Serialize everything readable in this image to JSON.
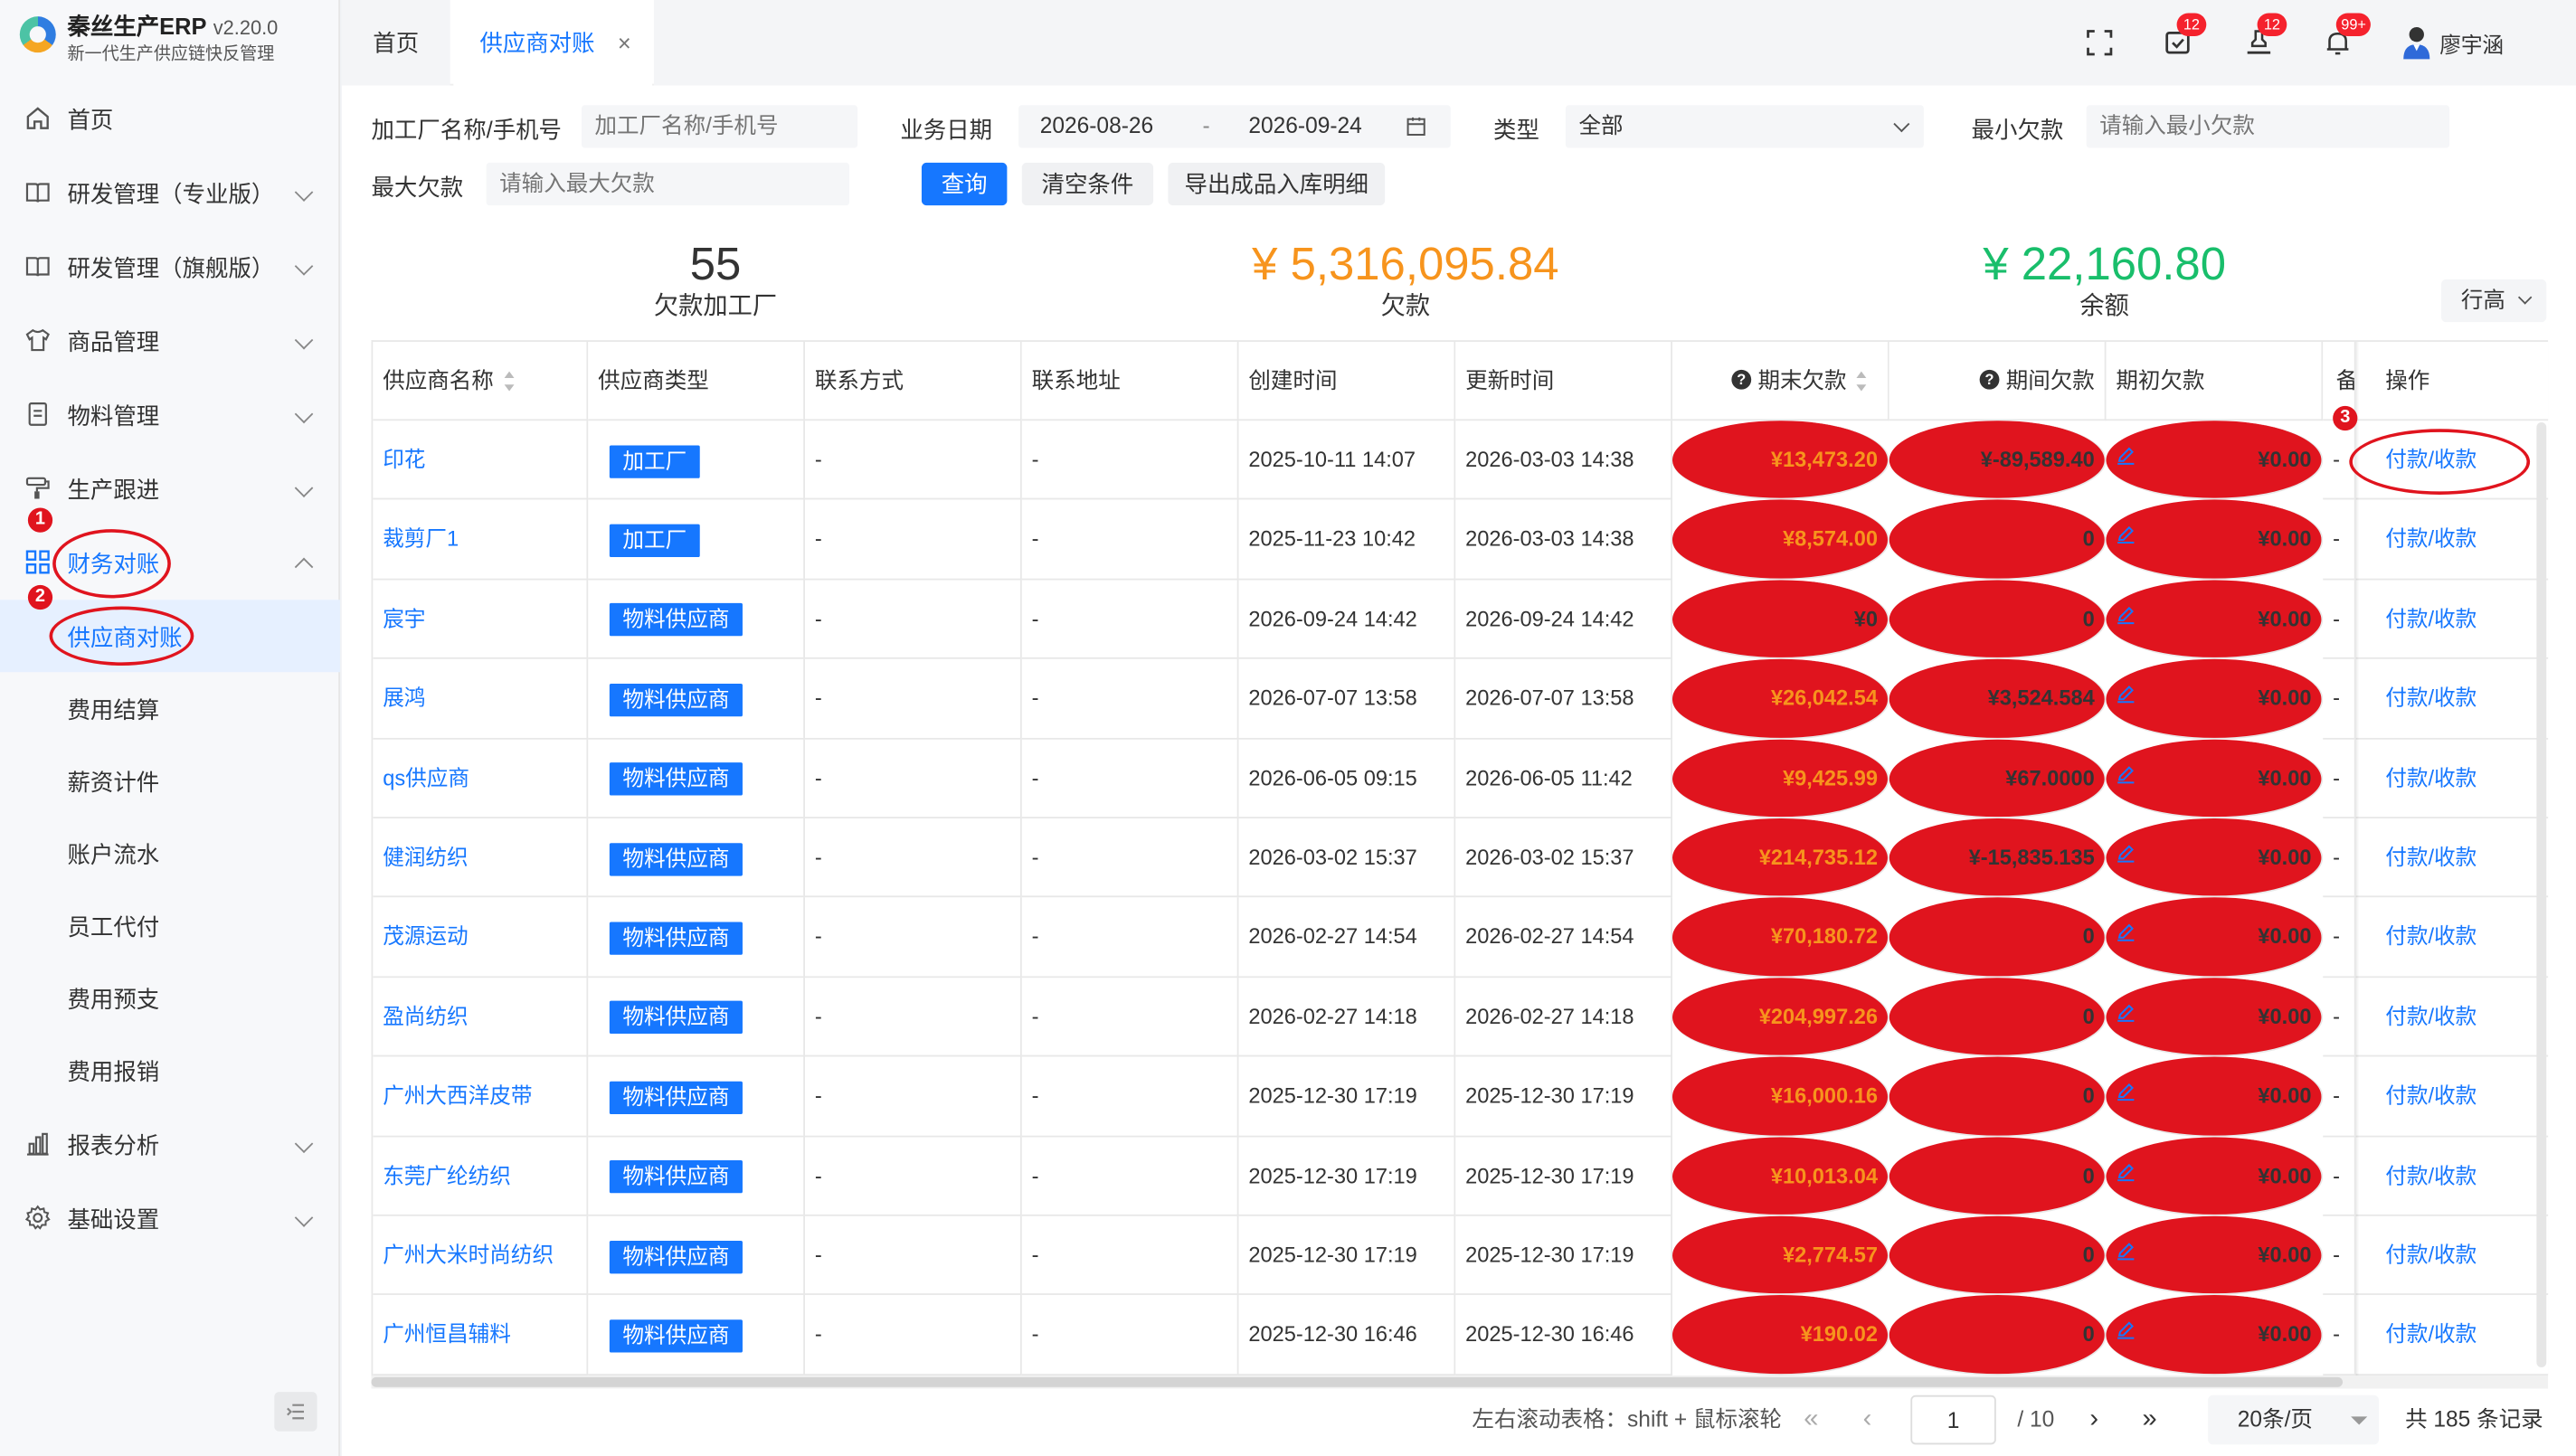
{
  "app": {
    "name": "秦丝生产ERP",
    "version": "v2.20.0",
    "slogan": "新一代生产供应链快反管理"
  },
  "sidebar": {
    "items": [
      {
        "label": "首页",
        "icon": "home-icon"
      },
      {
        "label": "研发管理（专业版）",
        "icon": "book-icon"
      },
      {
        "label": "研发管理（旗舰版）",
        "icon": "book-icon"
      },
      {
        "label": "商品管理",
        "icon": "shirt-icon"
      },
      {
        "label": "物料管理",
        "icon": "document-icon"
      },
      {
        "label": "生产跟进",
        "icon": "roller-icon"
      },
      {
        "label": "财务对账",
        "icon": "grid-icon"
      },
      {
        "label": "报表分析",
        "icon": "bar-chart-icon"
      },
      {
        "label": "基础设置",
        "icon": "gear-icon"
      }
    ],
    "finance_sub": [
      {
        "label": "供应商对账"
      },
      {
        "label": "费用结算"
      },
      {
        "label": "薪资计件"
      },
      {
        "label": "账户流水"
      },
      {
        "label": "员工代付"
      },
      {
        "label": "费用预支"
      },
      {
        "label": "费用报销"
      }
    ],
    "annotations": [
      "1",
      "2",
      "3"
    ]
  },
  "topbar": {
    "tabs": [
      {
        "label": "首页"
      },
      {
        "label": "供应商对账"
      }
    ],
    "close_glyph": "×",
    "badges": {
      "tasks": "12",
      "approvals": "12",
      "notifications": "99+"
    },
    "user_name": "廖宇涵"
  },
  "filters": {
    "factory_label": "加工厂名称/手机号",
    "factory_placeholder": "加工厂名称/手机号",
    "date_label": "业务日期",
    "date_start": "2026-08-26",
    "date_sep": "-",
    "date_end": "2026-09-24",
    "type_label": "类型",
    "type_value": "全部",
    "min_debt_label": "最小欠款",
    "min_debt_placeholder": "请输入最小欠款",
    "max_debt_label": "最大欠款",
    "max_debt_placeholder": "请输入最大欠款",
    "query_btn": "查询",
    "clear_btn": "清空条件",
    "export_btn": "导出成品入库明细"
  },
  "stats": {
    "factory_count": "55",
    "factory_count_label": "欠款加工厂",
    "debt": "¥ 5,316,095.84",
    "debt_label": "欠款",
    "balance": "¥ 22,160.80",
    "balance_label": "余额",
    "row_height_btn": "行高"
  },
  "colors": {
    "primary": "#1677ff",
    "orange": "#f7941d",
    "green": "#19be6b",
    "annotation": "#e0141e"
  },
  "table": {
    "columns": [
      "供应商名称",
      "供应商类型",
      "联系方式",
      "联系地址",
      "创建时间",
      "更新时间",
      "期末欠款",
      "期间欠款",
      "期初欠款",
      "备",
      "操作"
    ],
    "rows": [
      {
        "name": "印花",
        "type": "加工厂",
        "contact": "-",
        "address": "-",
        "created": "2025-10-11 14:07",
        "updated": "2026-03-03 14:38",
        "end_debt": "¥13,473.20",
        "period_debt": "¥-89,589.40",
        "begin_debt": "¥0.00",
        "remark": "-",
        "action": "付款/收款"
      },
      {
        "name": "裁剪厂1",
        "type": "加工厂",
        "contact": "-",
        "address": "-",
        "created": "2025-11-23 10:42",
        "updated": "2026-03-03 14:38",
        "end_debt": "¥8,574.00",
        "period_debt": "0",
        "begin_debt": "¥0.00",
        "remark": "-",
        "action": "付款/收款"
      },
      {
        "name": "宸宇",
        "type": "物料供应商",
        "contact": "-",
        "address": "-",
        "created": "2026-09-24 14:42",
        "updated": "2026-09-24 14:42",
        "end_debt": "¥0",
        "period_debt": "0",
        "begin_debt": "¥0.00",
        "remark": "-",
        "action": "付款/收款"
      },
      {
        "name": "展鸿",
        "type": "物料供应商",
        "contact": "-",
        "address": "-",
        "created": "2026-07-07 13:58",
        "updated": "2026-07-07 13:58",
        "end_debt": "¥26,042.54",
        "period_debt": "¥3,524.584",
        "begin_debt": "¥0.00",
        "remark": "-",
        "action": "付款/收款"
      },
      {
        "name": "qs供应商",
        "type": "物料供应商",
        "contact": "-",
        "address": "-",
        "created": "2026-06-05 09:15",
        "updated": "2026-06-05 11:42",
        "end_debt": "¥9,425.99",
        "period_debt": "¥67.0000",
        "begin_debt": "¥0.00",
        "remark": "-",
        "action": "付款/收款"
      },
      {
        "name": "健润纺织",
        "type": "物料供应商",
        "contact": "-",
        "address": "-",
        "created": "2026-03-02 15:37",
        "updated": "2026-03-02 15:37",
        "end_debt": "¥214,735.12",
        "period_debt": "¥-15,835.135",
        "begin_debt": "¥0.00",
        "remark": "-",
        "action": "付款/收款"
      },
      {
        "name": "茂源运动",
        "type": "物料供应商",
        "contact": "-",
        "address": "-",
        "created": "2026-02-27 14:54",
        "updated": "2026-02-27 14:54",
        "end_debt": "¥70,180.72",
        "period_debt": "0",
        "begin_debt": "¥0.00",
        "remark": "-",
        "action": "付款/收款"
      },
      {
        "name": "盈尚纺织",
        "type": "物料供应商",
        "contact": "-",
        "address": "-",
        "created": "2026-02-27 14:18",
        "updated": "2026-02-27 14:18",
        "end_debt": "¥204,997.26",
        "period_debt": "0",
        "begin_debt": "¥0.00",
        "remark": "-",
        "action": "付款/收款"
      },
      {
        "name": "广州大西洋皮带",
        "type": "物料供应商",
        "contact": "-",
        "address": "-",
        "created": "2025-12-30 17:19",
        "updated": "2025-12-30 17:19",
        "end_debt": "¥16,000.16",
        "period_debt": "0",
        "begin_debt": "¥0.00",
        "remark": "-",
        "action": "付款/收款"
      },
      {
        "name": "东莞广纶纺织",
        "type": "物料供应商",
        "contact": "-",
        "address": "-",
        "created": "2025-12-30 17:19",
        "updated": "2025-12-30 17:19",
        "end_debt": "¥10,013.04",
        "period_debt": "0",
        "begin_debt": "¥0.00",
        "remark": "-",
        "action": "付款/收款"
      },
      {
        "name": "广州大米时尚纺织",
        "type": "物料供应商",
        "contact": "-",
        "address": "-",
        "created": "2025-12-30 17:19",
        "updated": "2025-12-30 17:19",
        "end_debt": "¥2,774.57",
        "period_debt": "0",
        "begin_debt": "¥0.00",
        "remark": "-",
        "action": "付款/收款"
      },
      {
        "name": "广州恒昌辅料",
        "type": "物料供应商",
        "contact": "-",
        "address": "-",
        "created": "2025-12-30 16:46",
        "updated": "2025-12-30 16:46",
        "end_debt": "¥190.02",
        "period_debt": "0",
        "begin_debt": "¥0.00",
        "remark": "-",
        "action": "付款/收款"
      }
    ]
  },
  "pagination": {
    "scroll_hint": "左右滚动表格：shift + 鼠标滚轮",
    "current_page": "1",
    "total_pages": "/ 10",
    "page_size": "20条/页",
    "total": "共 185 条记录"
  }
}
